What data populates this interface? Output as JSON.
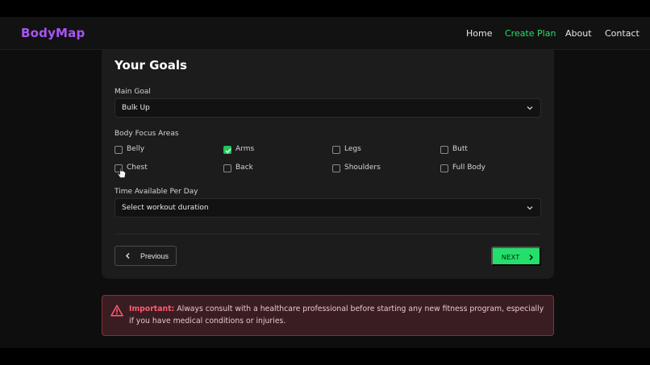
{
  "app": {
    "brand": "BodyMap"
  },
  "nav": {
    "items": [
      {
        "label": "Home",
        "active": false
      },
      {
        "label": "Create Plan",
        "active": true
      },
      {
        "label": "About",
        "active": false
      },
      {
        "label": "Contact",
        "active": false
      }
    ]
  },
  "form": {
    "title": "Your Goals",
    "main_goal": {
      "label": "Main Goal",
      "value": "Bulk Up"
    },
    "focus": {
      "label": "Body Focus Areas",
      "options": [
        {
          "label": "Belly",
          "checked": false
        },
        {
          "label": "Arms",
          "checked": true
        },
        {
          "label": "Legs",
          "checked": false
        },
        {
          "label": "Butt",
          "checked": false
        },
        {
          "label": "Chest",
          "checked": false
        },
        {
          "label": "Back",
          "checked": false
        },
        {
          "label": "Shoulders",
          "checked": false
        },
        {
          "label": "Full Body",
          "checked": false
        }
      ]
    },
    "time": {
      "label": "Time Available Per Day",
      "placeholder": "Select workout duration"
    },
    "buttons": {
      "previous": "Previous",
      "next": "NEXT"
    }
  },
  "alert": {
    "strong": "Important:",
    "text": "Always consult with a healthcare professional before starting any new fitness program, especially if you have medical conditions or injuries."
  },
  "colors": {
    "brand": "#a855f7",
    "accent": "#22e06a",
    "checkbox": "#22c55e",
    "alert_text": "#ff5a6e"
  },
  "icons": [
    "chevron-down-icon",
    "chevron-left-icon",
    "chevron-right-icon",
    "warning-icon",
    "check-icon",
    "cursor-icon"
  ]
}
